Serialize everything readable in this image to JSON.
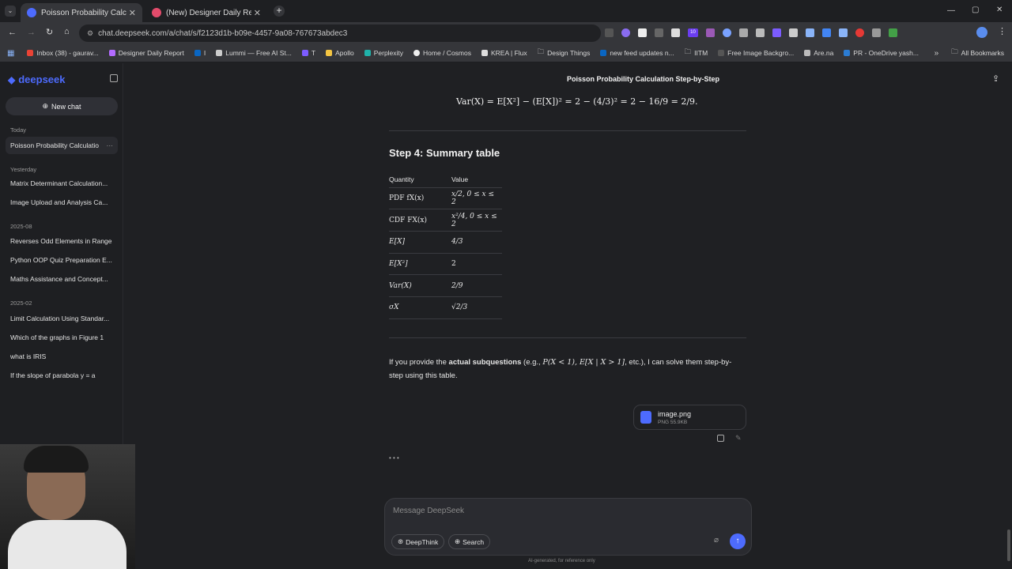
{
  "browser": {
    "tabs": [
      {
        "label": "Poisson Probability Calculation",
        "active": true
      },
      {
        "label": "(New) Designer Daily Report",
        "active": false
      }
    ],
    "url": "chat.deepseek.com/a/chat/s/f2123d1b-b09e-4457-9a08-767673abdec3",
    "bookmarks": [
      "Inbox (38) - gaurav...",
      "Designer Daily Report",
      "I",
      "Lummi — Free AI St...",
      "T",
      "Apollo",
      "Perplexity",
      "Home / Cosmos",
      "KREA | Flux",
      "Design Things",
      "new feed updates n...",
      "IITM",
      "Free Image Backgro...",
      "Are.na",
      "PR - OneDrive yash..."
    ],
    "all_bookmarks": "All Bookmarks",
    "extension_badge": "10"
  },
  "sidebar": {
    "logo": "deepseek",
    "new_chat": "New chat",
    "sections": [
      {
        "label": "Today",
        "items": [
          "Poisson Probability Calculatio"
        ]
      },
      {
        "label": "Yesterday",
        "items": [
          "Matrix Determinant Calculation...",
          "Image Upload and Analysis Ca..."
        ]
      },
      {
        "label": "2025-08",
        "items": [
          "Reverses Odd Elements in Range",
          "Python OOP Quiz Preparation E...",
          "Maths Assistance and Concept..."
        ]
      },
      {
        "label": "2025-02",
        "items": [
          "Limit Calculation Using Standar...",
          "Which of the graphs in Figure 1",
          "what is IRIS",
          "If the slope of parabola y = a"
        ]
      }
    ]
  },
  "chat": {
    "title": "Poisson Probability Calculation Step-by-Step",
    "variance_formula": "Var(X) = E[X²] − (E[X])² = 2 − (4/3)² = 2 − 16/9 = 2/9.",
    "step_heading": "Step 4: Summary table",
    "table": {
      "headers": [
        "Quantity",
        "Value"
      ],
      "rows": [
        [
          "PDF fX(x)",
          "x/2, 0 ≤ x ≤ 2"
        ],
        [
          "CDF FX(x)",
          "x²/4, 0 ≤ x ≤ 2"
        ],
        [
          "E[X]",
          "4/3"
        ],
        [
          "E[X²]",
          "2"
        ],
        [
          "Var(X)",
          "2/9"
        ],
        [
          "σX",
          "√2/3"
        ]
      ]
    },
    "para_prefix": "If you provide the ",
    "para_bold": "actual subquestions",
    "para_mid": " (e.g., ",
    "para_math": "P(X < 1), E[X | X > 1]",
    "para_suffix": ", etc.), I can solve them step-by-step using this table.",
    "file": {
      "name": "image.png",
      "meta": "PNG 55.9KB"
    },
    "typing": "• • •"
  },
  "composer": {
    "placeholder": "Message DeepSeek",
    "deepthink": "DeepThink",
    "search": "Search",
    "footer": "AI-generated, for reference only"
  },
  "colors": {
    "accent": "#4d6bfe",
    "bg": "#1f2023"
  }
}
